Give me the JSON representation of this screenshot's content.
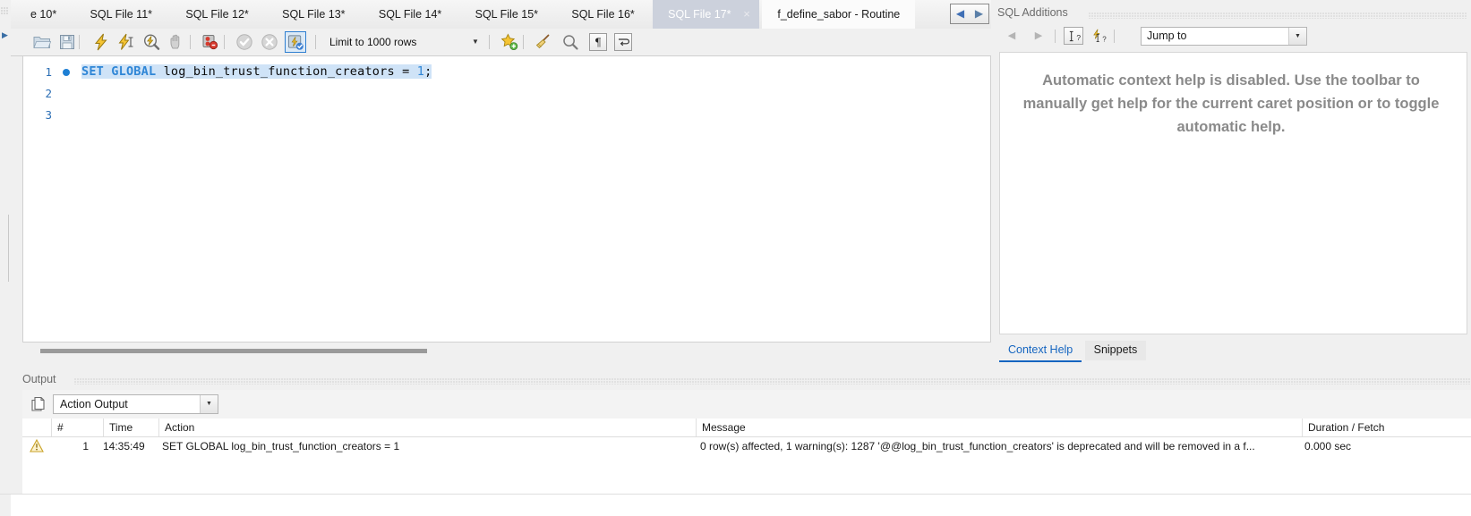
{
  "tabs": [
    {
      "label": "e 10*",
      "active": false,
      "closable": false
    },
    {
      "label": "SQL File 11*",
      "active": false,
      "closable": false
    },
    {
      "label": "SQL File 12*",
      "active": false,
      "closable": false
    },
    {
      "label": "SQL File 13*",
      "active": false,
      "closable": false
    },
    {
      "label": "SQL File 14*",
      "active": false,
      "closable": false
    },
    {
      "label": "SQL File 15*",
      "active": false,
      "closable": false
    },
    {
      "label": "SQL File 16*",
      "active": false,
      "closable": false
    },
    {
      "label": "SQL File 17*",
      "active": true,
      "closable": true
    },
    {
      "label": "f_define_sabor - Routine",
      "active": false,
      "closable": false
    }
  ],
  "tab_close_glyph": "×",
  "tab_nav": {
    "prev_glyph": "◀",
    "next_glyph": "▶"
  },
  "toolbar": {
    "open_file": "open-sql-script-file",
    "save_file": "save-sql-script",
    "execute": "execute-statement",
    "execute_current": "execute-current-statement",
    "explain": "explain-current-statement",
    "stop": "stop-statement",
    "toggle_stop_on_error": "toggle-stop-on-error",
    "commit": "commit-transaction",
    "rollback": "rollback-transaction",
    "autocommit": "toggle-autocommit",
    "limit_label": "Limit to 1000 rows",
    "limit_arrow_glyph": "▼",
    "snippet": "save-snippet",
    "beautify": "beautify-query",
    "find": "find-panel",
    "invisible_chars": "toggle-invisible-characters",
    "wrap_lines": "toggle-word-wrap"
  },
  "editor": {
    "lines": [
      {
        "number": "1",
        "has_marker": true,
        "selected": true,
        "tokens": [
          {
            "text": "SET GLOBAL ",
            "type": "kw"
          },
          {
            "text": "log_bin_trust_function_creators ",
            "type": "ident"
          },
          {
            "text": "= ",
            "type": "op"
          },
          {
            "text": "1",
            "type": "num"
          },
          {
            "text": ";",
            "type": "op"
          }
        ]
      },
      {
        "number": "2",
        "has_marker": false,
        "selected": false,
        "tokens": []
      },
      {
        "number": "3",
        "has_marker": false,
        "selected": false,
        "tokens": []
      }
    ]
  },
  "sql_additions": {
    "caption": "SQL Additions",
    "prev_glyph": "◀",
    "next_glyph": "▶",
    "help_icon_name": "context-help-icon",
    "auto_help_icon_name": "automatic-context-help-icon",
    "jump_to_value": "Jump to",
    "jump_to_arrow_glyph": "▼",
    "help_message": "Automatic context help is disabled. Use the toolbar to manually get help for the current caret position or to toggle automatic help.",
    "tabs": [
      {
        "label": "Context Help",
        "active": true
      },
      {
        "label": "Snippets",
        "active": false
      }
    ]
  },
  "output": {
    "caption": "Output",
    "copy_icon_name": "copy-rows-icon",
    "selector_value": "Action Output",
    "selector_arrow_glyph": "▼",
    "columns": [
      "#",
      "Time",
      "Action",
      "Message",
      "Duration / Fetch"
    ],
    "rows": [
      {
        "status": "warning",
        "num": "1",
        "time": "14:35:49",
        "action": "SET GLOBAL log_bin_trust_function_creators = 1",
        "message": "0 row(s) affected, 1 warning(s): 1287 '@@log_bin_trust_function_creators' is deprecated and will be removed in a f...",
        "duration": "0.000 sec"
      }
    ]
  },
  "colors": {
    "accent_blue": "#2f86d6",
    "selection": "#cfe3f7",
    "active_tab_bg": "#ccd1dc",
    "link_blue": "#1565c0",
    "help_text": "#8a8a8a"
  }
}
